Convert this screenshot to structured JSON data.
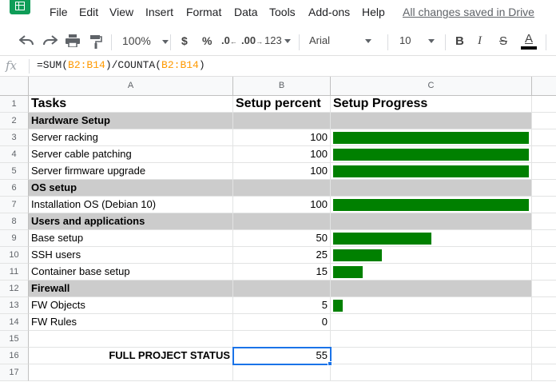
{
  "menu": {
    "items": [
      "File",
      "Edit",
      "View",
      "Insert",
      "Format",
      "Data",
      "Tools",
      "Add-ons",
      "Help"
    ],
    "save_status": "All changes saved in Drive"
  },
  "toolbar": {
    "zoom": "100%",
    "currency": "$",
    "percent": "%",
    "decrease_decimals": ".0",
    "increase_decimals": ".00",
    "more_formats": "123",
    "font": "Arial",
    "font_size": "10",
    "bold": "B",
    "italic": "I",
    "strikethrough": "S",
    "text_color": "A"
  },
  "formula_bar": {
    "fx_label": "fx",
    "formula_parts": [
      "=SUM(",
      "B2:B14",
      ")/COUNTA(",
      "B2:B14",
      ")"
    ]
  },
  "columns": [
    "A",
    "B",
    "C"
  ],
  "rows": [
    "1",
    "2",
    "3",
    "4",
    "5",
    "6",
    "7",
    "8",
    "9",
    "10",
    "11",
    "12",
    "13",
    "14",
    "15",
    "16",
    "17"
  ],
  "sheet": {
    "header": {
      "a": "Tasks",
      "b": "Setup percent",
      "c": "Setup Progress"
    },
    "data_rows": [
      {
        "a": "Hardware Setup",
        "b": "",
        "section": true
      },
      {
        "a": "Server racking",
        "b": "100",
        "progress": 100
      },
      {
        "a": "Server cable patching",
        "b": "100",
        "progress": 100
      },
      {
        "a": "Server firmware upgrade",
        "b": "100",
        "progress": 100
      },
      {
        "a": "OS setup",
        "b": "",
        "section": true
      },
      {
        "a": "Installation OS (Debian 10)",
        "b": "100",
        "progress": 100
      },
      {
        "a": "Users and applications",
        "b": "",
        "section": true
      },
      {
        "a": "Base setup",
        "b": "50",
        "progress": 50
      },
      {
        "a": "SSH users",
        "b": "25",
        "progress": 25
      },
      {
        "a": "Container base setup",
        "b": "15",
        "progress": 15
      },
      {
        "a": "Firewall",
        "b": "",
        "section": true
      },
      {
        "a": "FW Objects",
        "b": "5",
        "progress": 5
      },
      {
        "a": "FW Rules",
        "b": "0",
        "progress": 0
      },
      {
        "a": "",
        "b": ""
      },
      {
        "a": "FULL PROJECT STATUS",
        "b": "55",
        "status": true
      },
      {
        "a": "",
        "b": ""
      }
    ]
  },
  "colors": {
    "progress_bar": "#008000",
    "section_fill": "#cccccc",
    "selection": "#1a73e8",
    "logo": "#0f9d58"
  }
}
